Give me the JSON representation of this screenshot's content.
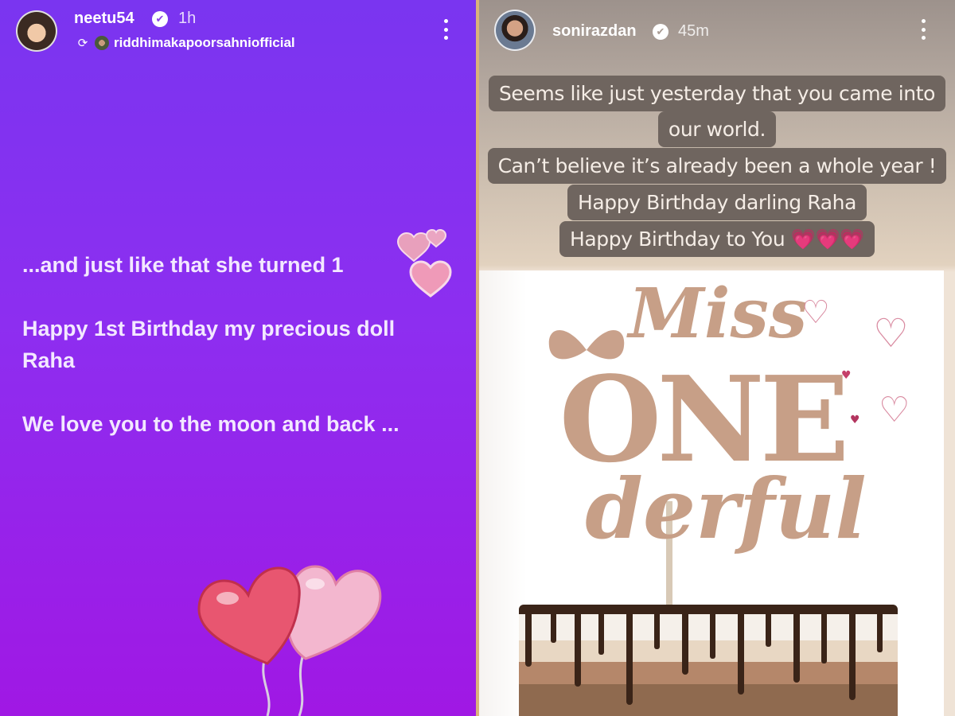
{
  "left_story": {
    "username": "neetu54",
    "verified_glyph": "✔",
    "time_ago": "1h",
    "reposted_from": "riddhimakapoorsahniofficial",
    "lines": [
      "...and just like that she turned 1",
      "Happy 1st Birthday my precious doll",
      "Raha",
      "We love you to the moon and back ..."
    ],
    "sticker_icons": [
      "hearts-sticker",
      "heart-balloons-sticker"
    ]
  },
  "right_story": {
    "username": "sonirazdan",
    "verified_glyph": "✔",
    "time_ago": "45m",
    "caption_lines": [
      "Seems like just yesterday that you came into",
      "our world.",
      "Can’t believe it’s already been a whole year !",
      "Happy Birthday darling Raha",
      "Happy Birthday to You 💗💗💗"
    ],
    "cake_topper": {
      "line1": "Miss",
      "line2": "ONE",
      "line3": "derful"
    }
  },
  "colors": {
    "left_gradient_top": "#7a35f0",
    "left_gradient_bottom": "#a018e4",
    "caption_pill": "#6f655f"
  }
}
